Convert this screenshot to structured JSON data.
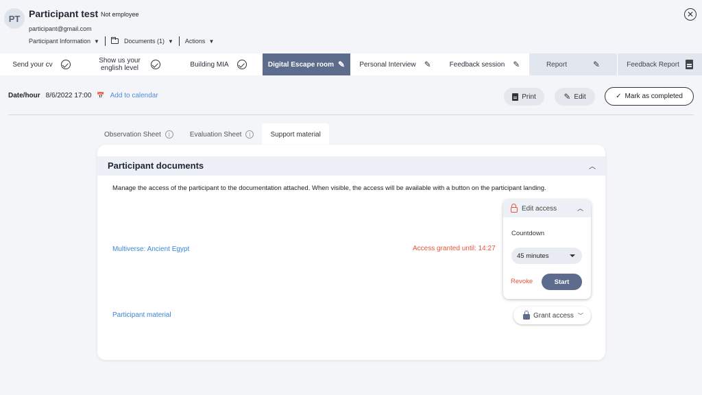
{
  "participant": {
    "initials": "PT",
    "name": "Participant test",
    "badge": "Not employee",
    "email": "participant@gmail.com"
  },
  "menus": {
    "participant_info": "Participant Information",
    "documents": "Documents (1)",
    "actions": "Actions"
  },
  "icons": {
    "close": "close-circle-icon",
    "check": "check-circle-icon",
    "pencil": "pencil-icon",
    "document": "document-icon",
    "calendar": "calendar-icon",
    "lock_open": "lock-open-icon",
    "lock": "lock-icon"
  },
  "steps": [
    {
      "label": "Send your cv",
      "state": "done"
    },
    {
      "label": "Show us your english level",
      "state": "done"
    },
    {
      "label": "Building MIA",
      "state": "done"
    },
    {
      "label": "Digital Escape room",
      "state": "active"
    },
    {
      "label": "Personal Interview",
      "state": "editable"
    },
    {
      "label": "Feedback session",
      "state": "editable"
    },
    {
      "label": "Report",
      "state": "locked"
    },
    {
      "label": "Feedback Report",
      "state": "locked"
    }
  ],
  "session": {
    "date_label": "Date/hour",
    "date_value": "8/6/2022 17:00",
    "calendar_link": "Add to calendar"
  },
  "toolbar": {
    "print": "Print",
    "edit": "Edit",
    "complete": "Mark as completed"
  },
  "subtabs": [
    {
      "label": "Observation Sheet",
      "active": false
    },
    {
      "label": "Evaluation Sheet",
      "active": false
    },
    {
      "label": "Support material",
      "active": true
    }
  ],
  "card": {
    "title": "Participant documents",
    "description": "Manage the access of the participant to the documentation attached. When visible, the access will be available with a button on the participant landing."
  },
  "documents": [
    {
      "name": "Multiverse: Ancient Egypt",
      "status": "Access granted until: 14:27"
    },
    {
      "name": "Participant material",
      "status": ""
    }
  ],
  "access_panel": {
    "title": "Edit access",
    "countdown_label": "Countdown",
    "countdown_value": "45 minutes",
    "revoke": "Revoke",
    "start": "Start"
  },
  "grant_button": "Grant access",
  "colors": {
    "accent": "#5d6b8d",
    "link": "#3a86d6",
    "danger": "#e8533a"
  }
}
